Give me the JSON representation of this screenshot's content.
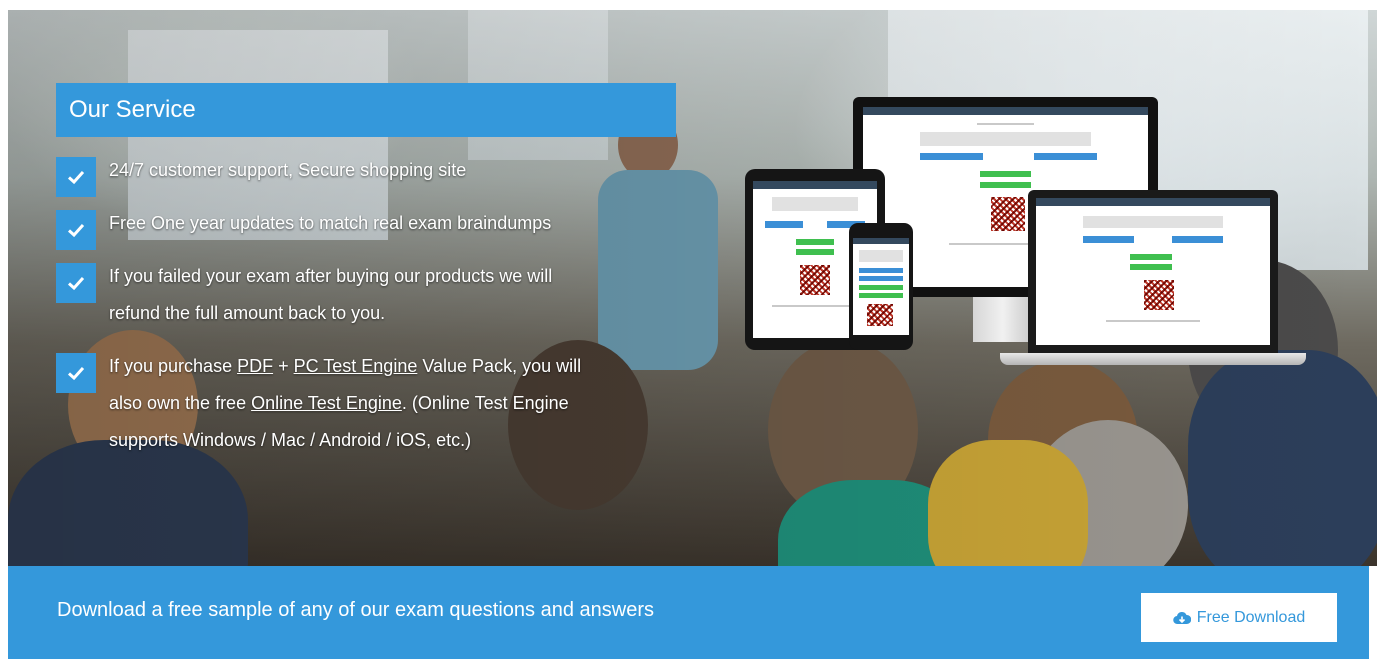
{
  "service": {
    "title": "Our Service",
    "items": [
      {
        "text": "24/7 customer support, Secure shopping site"
      },
      {
        "text": "Free One year updates to match real exam braindumps"
      },
      {
        "line1": "If you failed your exam after buying our products we will",
        "line2": "refund the full amount back to you."
      },
      {
        "pre": "If you purchase ",
        "link_pdf": "PDF",
        "plus": " + ",
        "link_pc": "PC Test Engine",
        "mid": " Value Pack, you will",
        "pre2": "also own the free ",
        "link_online": "Online Test Engine",
        "post": ". (Online Test Engine",
        "line3": "supports Windows / Mac / Android / iOS, etc.)"
      }
    ]
  },
  "download": {
    "text": "Download a free sample of any of our exam questions and answers",
    "button_label": "Free Download",
    "button_icon": "cloud-download-icon"
  },
  "icons": {
    "check": "check-icon"
  },
  "colors": {
    "accent": "#3498db",
    "text_light": "#ffffff"
  }
}
